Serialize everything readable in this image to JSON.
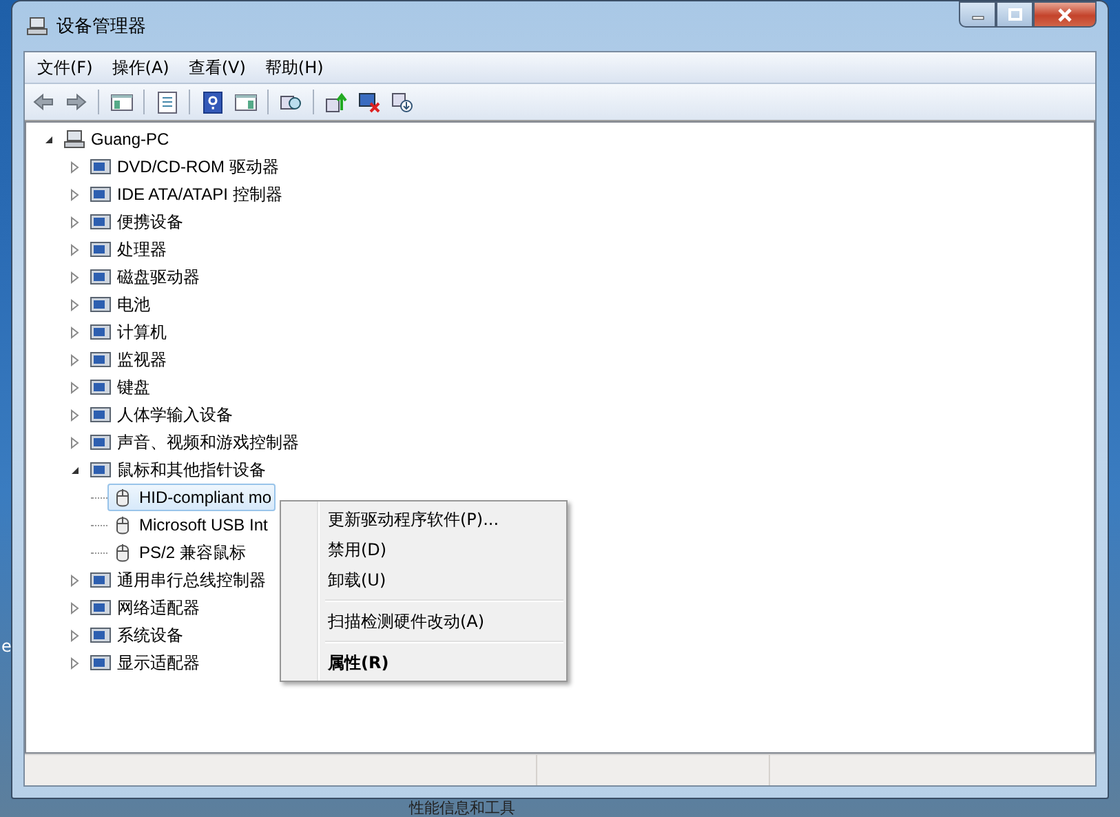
{
  "window": {
    "title": "设备管理器"
  },
  "menu_bar": [
    {
      "label": "文件(F)"
    },
    {
      "label": "操作(A)"
    },
    {
      "label": "查看(V)"
    },
    {
      "label": "帮助(H)"
    }
  ],
  "tree": {
    "label": "Guang-PC",
    "expanded": true,
    "selected": false,
    "children": [
      {
        "label": "DVD/CD-ROM 驱动器",
        "expanded": false,
        "selected": false
      },
      {
        "label": "IDE ATA/ATAPI 控制器",
        "expanded": false,
        "selected": false
      },
      {
        "label": "便携设备",
        "expanded": false,
        "selected": false
      },
      {
        "label": "处理器",
        "expanded": false,
        "selected": false
      },
      {
        "label": "磁盘驱动器",
        "expanded": false,
        "selected": false
      },
      {
        "label": "电池",
        "expanded": false,
        "selected": false
      },
      {
        "label": "计算机",
        "expanded": false,
        "selected": false
      },
      {
        "label": "监视器",
        "expanded": false,
        "selected": false
      },
      {
        "label": "键盘",
        "expanded": false,
        "selected": false
      },
      {
        "label": "人体学输入设备",
        "expanded": false,
        "selected": false
      },
      {
        "label": "声音、视频和游戏控制器",
        "expanded": false,
        "selected": false
      },
      {
        "label": "鼠标和其他指针设备",
        "expanded": true,
        "selected": false,
        "children": [
          {
            "label": "HID-compliant mo",
            "selected": true
          },
          {
            "label": "Microsoft USB Int",
            "selected": false
          },
          {
            "label": "PS/2 兼容鼠标",
            "selected": false
          }
        ]
      },
      {
        "label": "通用串行总线控制器",
        "expanded": false,
        "selected": false
      },
      {
        "label": "网络适配器",
        "expanded": false,
        "selected": false
      },
      {
        "label": "系统设备",
        "expanded": false,
        "selected": false
      },
      {
        "label": "显示适配器",
        "expanded": false,
        "selected": false
      }
    ]
  },
  "context_menu": {
    "items": [
      {
        "kind": "item",
        "label": "更新驱动程序软件(P)...",
        "default": false
      },
      {
        "kind": "item",
        "label": "禁用(D)",
        "default": false
      },
      {
        "kind": "item",
        "label": "卸载(U)",
        "default": false
      },
      {
        "kind": "separator"
      },
      {
        "kind": "item",
        "label": "扫描检测硬件改动(A)",
        "default": false
      },
      {
        "kind": "separator"
      },
      {
        "kind": "item",
        "label": "属性(R)",
        "default": true
      }
    ]
  },
  "desktop": {
    "left_edge_text": "e",
    "bottom_text": "性能信息和工具"
  }
}
